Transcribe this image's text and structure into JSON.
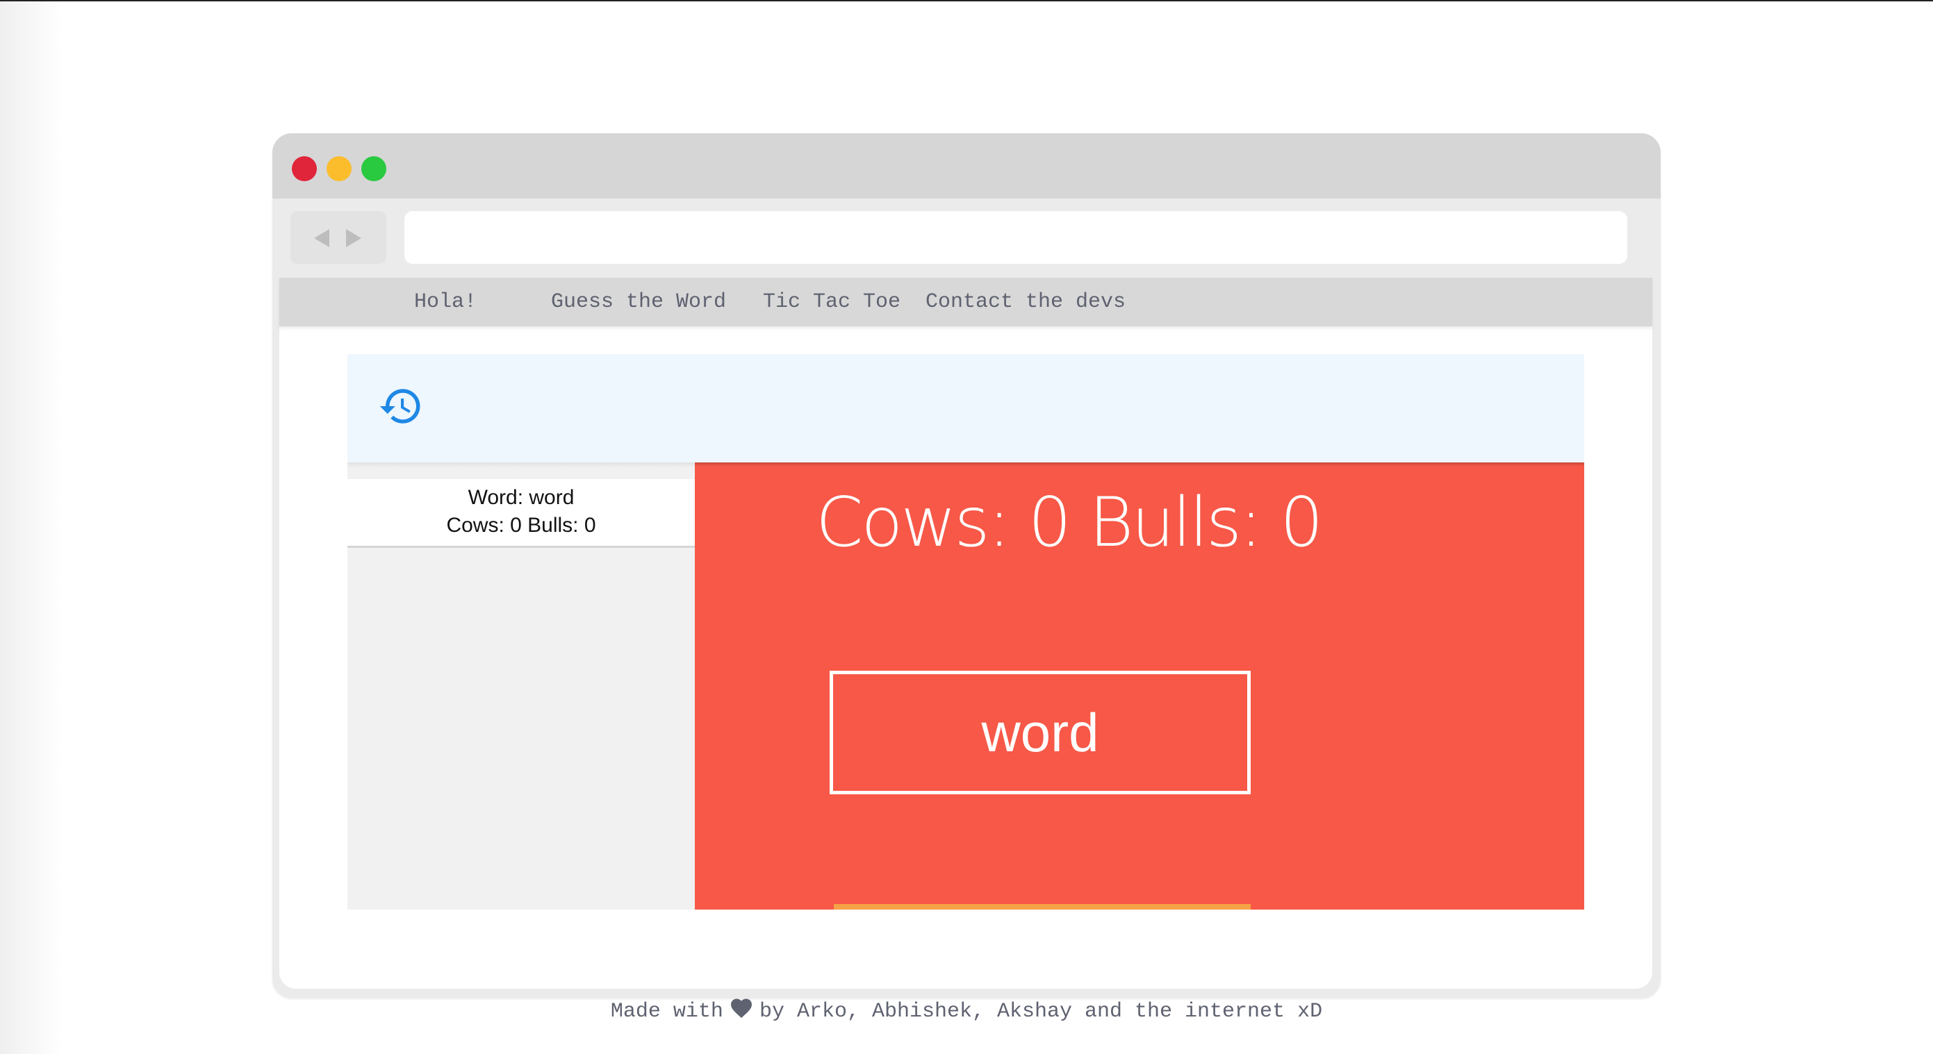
{
  "nav": {
    "items": [
      {
        "label": "Hola!"
      },
      {
        "label": "Guess the Word"
      },
      {
        "label": "Tic Tac Toe"
      },
      {
        "label": "Contact the devs"
      }
    ]
  },
  "history": {
    "icon": "history-icon",
    "entries": [
      {
        "word_line": "Word: word",
        "result_line": "Cows: 0 Bulls: 0"
      }
    ]
  },
  "game": {
    "score_text": "Cows: 0 Bulls: 0",
    "word_value": "word"
  },
  "footer": {
    "prefix": "Made with",
    "icon": "heart-icon",
    "suffix": "by Arko, Abhishek, Akshay and the internet xD"
  },
  "colors": {
    "game_background": "#f75847",
    "header_band": "#eef6fe",
    "accent_icon": "#1e88e5",
    "nav_text": "#5f6270"
  }
}
